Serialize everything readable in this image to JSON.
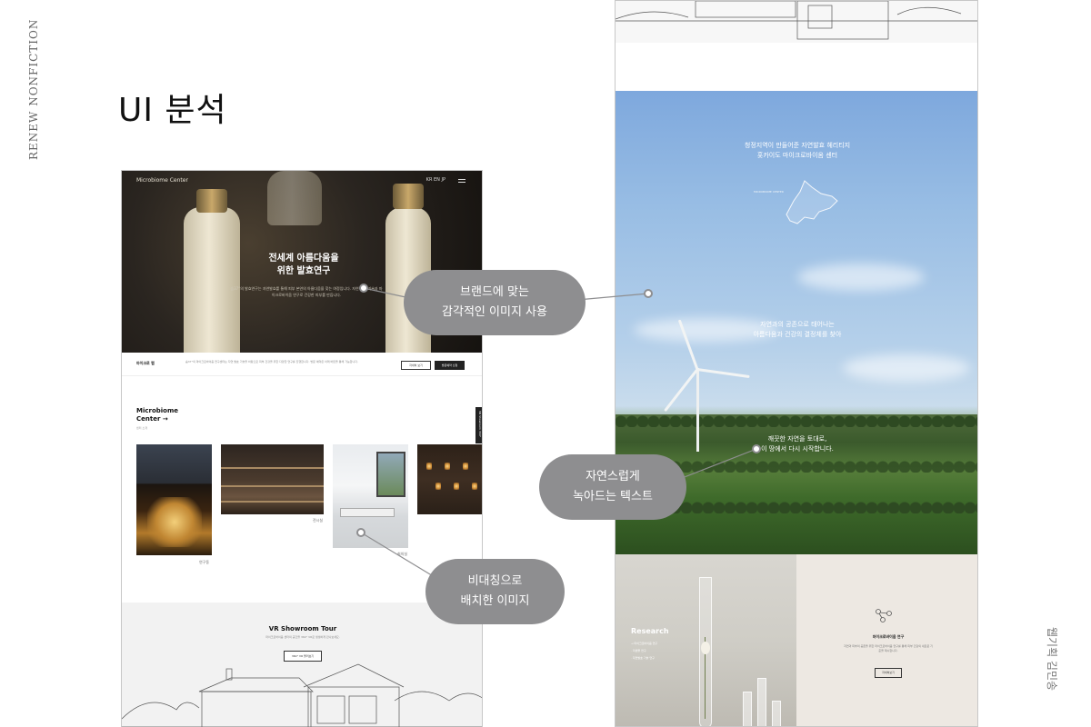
{
  "side_brand": "RENEW NONFICTION",
  "side_author": "웹기획 김민송",
  "title": "UI 분석",
  "left_mockup": {
    "logo": "Microbiome Center",
    "nav": "KR EN JP",
    "hero_headline_1": "전세계 아름다움을",
    "hero_headline_2": "위한 발효연구",
    "hero_desc": "숨37°의 발효연구는 자연발효를 통해 피부 본연의 아름다움을 찾는 여정입니다. 자연 발효 기술과 마이크로바이옴 연구로 건강한 피부를 만듭니다.",
    "info_label": "마이크로 랩",
    "info_text": "숨37°의 마이크로바이옴 연구센터는 자연 발효 기술을 바탕으로 피부 건강을 위한 다양한 연구를 진행합니다. 방문 예약은 아래 버튼을 통해 가능합니다.",
    "info_btn_1": "자세히 보기",
    "info_btn_2": "방문예약 신청",
    "mc_title_1": "Microbiome",
    "mc_title_2": "Center →",
    "mc_sub": "센터 소개",
    "vr_badge": "VR Showroom 360°",
    "caption_1": "연구동",
    "caption_2": "전시실",
    "caption_3": "회의실",
    "vr_title": "VR Showroom Tour",
    "vr_desc": "마이크로바이옴 센터의 공간을 360° VR로 생생하게 만나보세요.",
    "vr_button": "360° VR 둘러보기"
  },
  "right_mockup": {
    "text_1": "청정지역이 만들어준 자연발효 헤리티지\n홋카이도 마이크로바이옴 센터",
    "map_label": "MICROBIOME CENTER",
    "text_2": "자연과의 공존으로 태어나는\n아름다움과 건강의 결정체를 찾아",
    "text_3": "깨끗한 자연을 토대로,\n이 땅에서 다시 시작합니다.",
    "research_title": "Research",
    "research_items": [
      "→ 마이크로바이옴 연구",
      "· 미생물 연구",
      "· 자연발효 기술 연구"
    ],
    "panel_title": "마이크로바이옴 연구",
    "panel_desc": "자연과 피부의 공존을 위한 마이크로바이옴 연구를 통해 피부 건강의 새로운 기준을 제시합니다.",
    "panel_button": "자세히보기"
  },
  "callouts": {
    "image": [
      "브랜드에 맞는",
      "감각적인 이미지 사용"
    ],
    "text": [
      "자연스럽게",
      "녹아드는 텍스트"
    ],
    "layout": [
      "비대칭으로",
      "배치한 이미지"
    ]
  }
}
